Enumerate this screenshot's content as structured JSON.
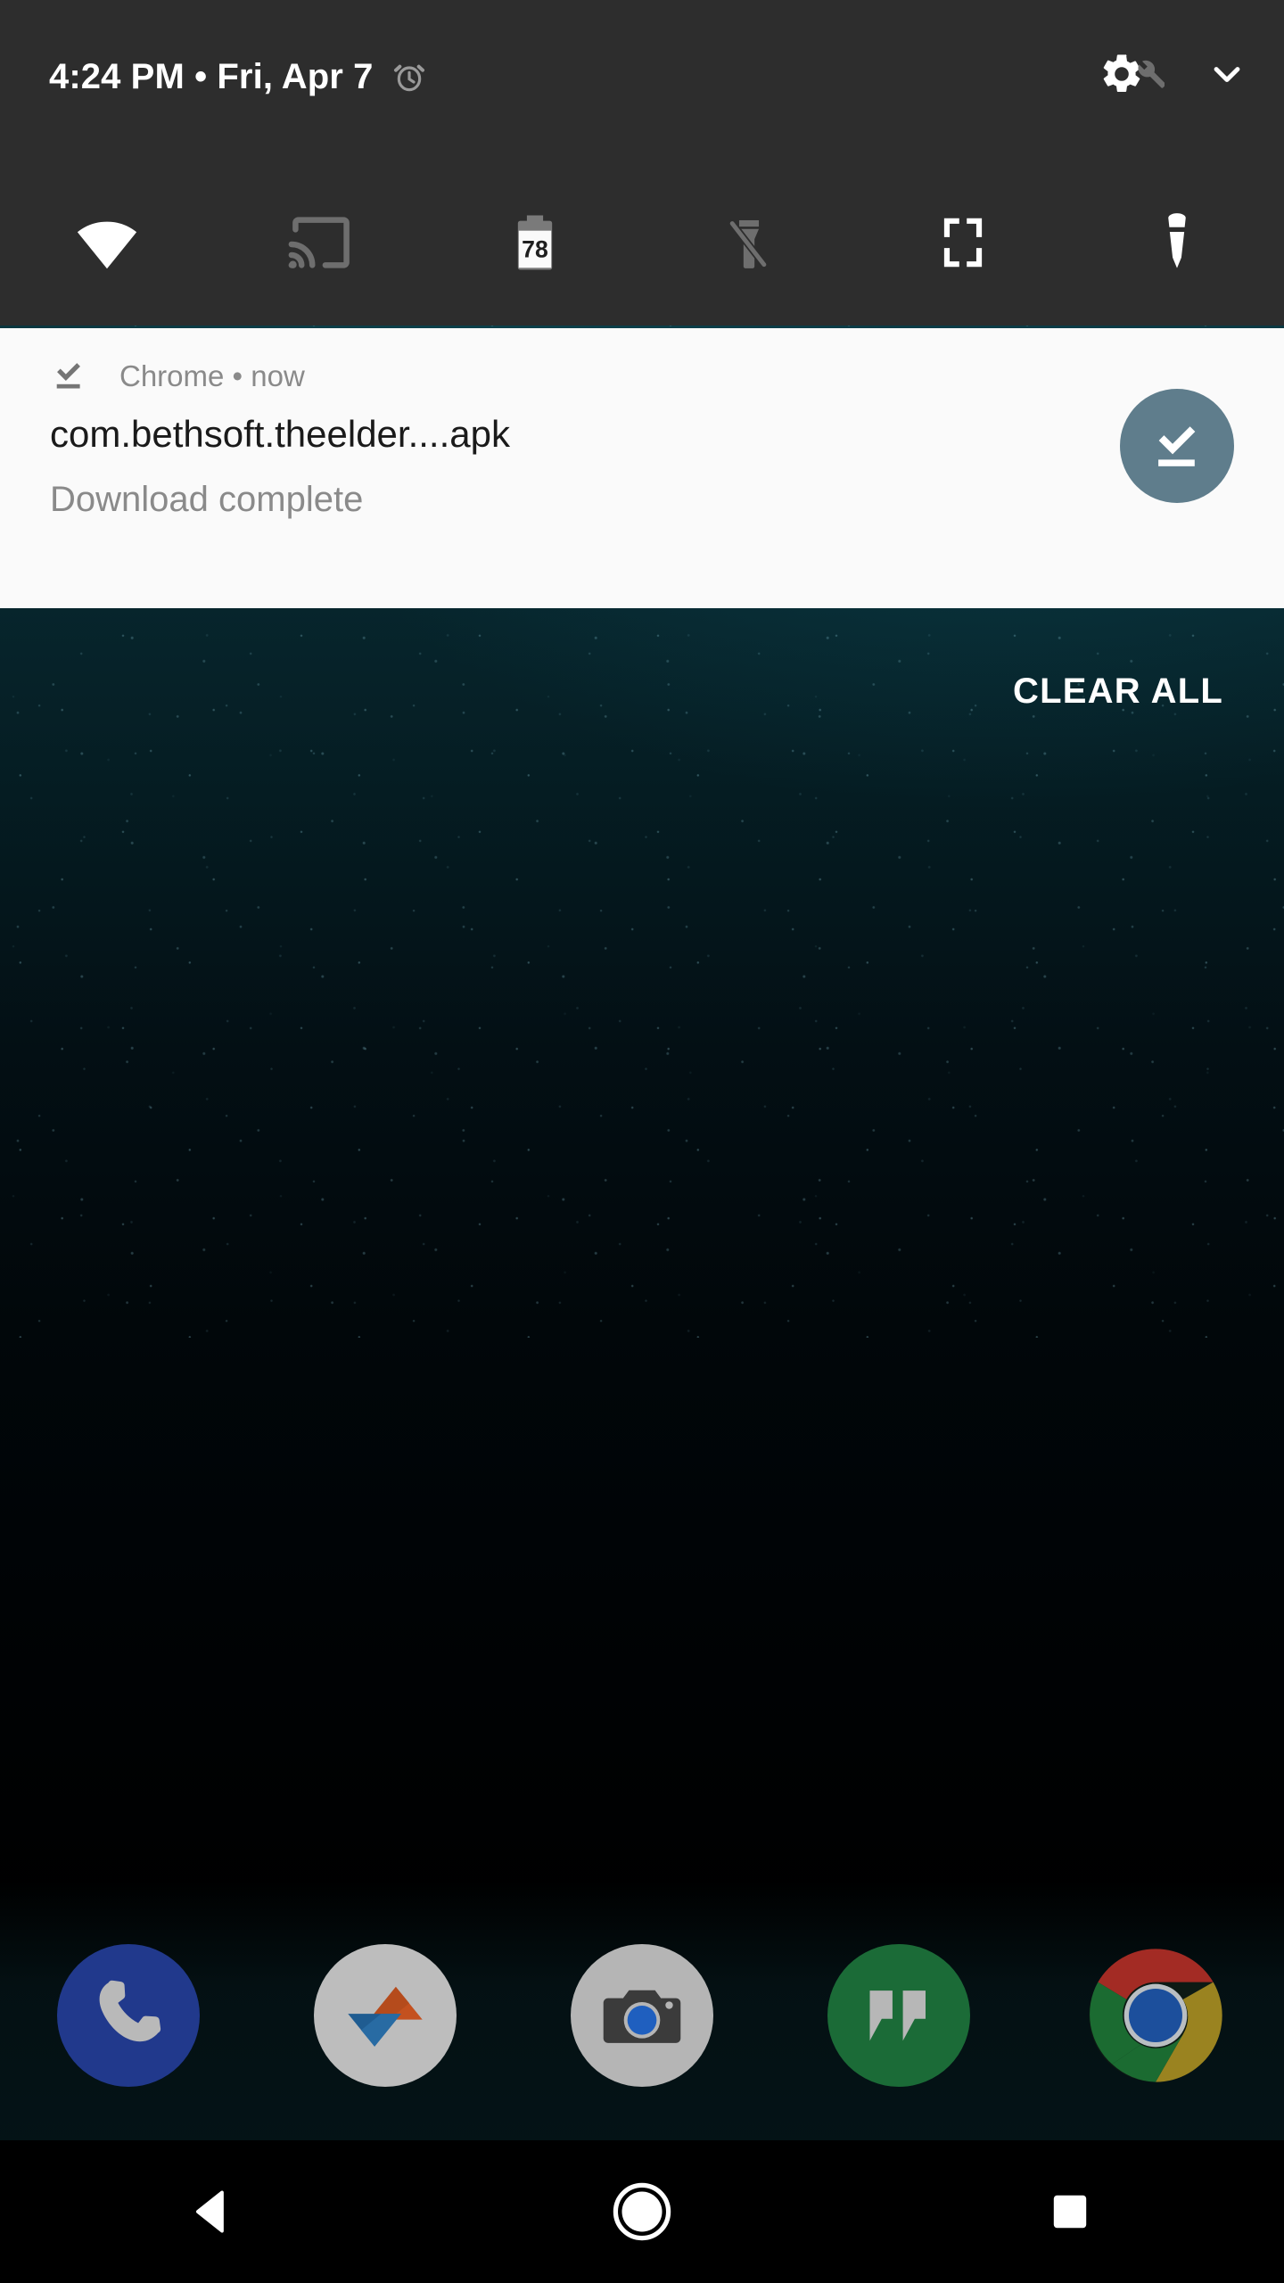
{
  "status_bar": {
    "clock_and_date": "4:24 PM • Fri, Apr 7",
    "alarm_icon": "alarm-clock-icon",
    "settings_icon": "gear-icon",
    "tuner_icon": "wrench-icon",
    "expand_icon": "chevron-down-icon"
  },
  "quick_settings": {
    "tiles": [
      {
        "name": "wifi",
        "icon": "wifi-icon",
        "state": "on",
        "label": "Wi-Fi"
      },
      {
        "name": "cast",
        "icon": "cast-icon",
        "state": "off",
        "label": "Cast"
      },
      {
        "name": "battery",
        "icon": "battery-icon",
        "state": "on",
        "label": "Battery",
        "value": "78"
      },
      {
        "name": "flashlight-off",
        "icon": "flashlight-off-icon",
        "state": "off",
        "label": "Flashlight"
      },
      {
        "name": "rotation-lock",
        "icon": "rotation-lock-icon",
        "state": "on",
        "label": "Auto-rotate"
      },
      {
        "name": "torch",
        "icon": "torch-icon",
        "state": "on",
        "label": "Torch"
      }
    ]
  },
  "notification": {
    "app_name": "Chrome",
    "separator": "•",
    "time": "now",
    "source_line": "Chrome • now",
    "title": "com.bethsoft.theelder....apk",
    "body": "Download complete",
    "small_icon": "download-done-icon",
    "action_icon": "download-done-icon",
    "action_circle_color": "#5f7d8c"
  },
  "shade": {
    "clear_all_label": "CLEAR ALL",
    "panel_color": "#2d2d2d",
    "card_color": "#fafafa"
  },
  "dock": {
    "items": [
      {
        "name": "phone",
        "label": "Phone",
        "icon": "phone-icon",
        "bg": "#21398c"
      },
      {
        "name": "photos",
        "label": "Photos",
        "icon": "triangles-icon",
        "bg": "#bdbdbd"
      },
      {
        "name": "camera",
        "label": "Camera",
        "icon": "camera-icon",
        "bg": "#b5b5b5"
      },
      {
        "name": "hangouts",
        "label": "Hangouts",
        "icon": "quote-icon",
        "bg": "#1b6b37"
      },
      {
        "name": "chrome",
        "label": "Chrome",
        "icon": "chrome-icon",
        "bg": "#ffffff"
      }
    ]
  },
  "nav_bar": {
    "buttons": [
      {
        "name": "back",
        "label": "Back",
        "icon": "back-triangle-icon"
      },
      {
        "name": "home",
        "label": "Home",
        "icon": "home-circle-icon"
      },
      {
        "name": "recents",
        "label": "Recents",
        "icon": "recents-square-icon"
      }
    ]
  }
}
